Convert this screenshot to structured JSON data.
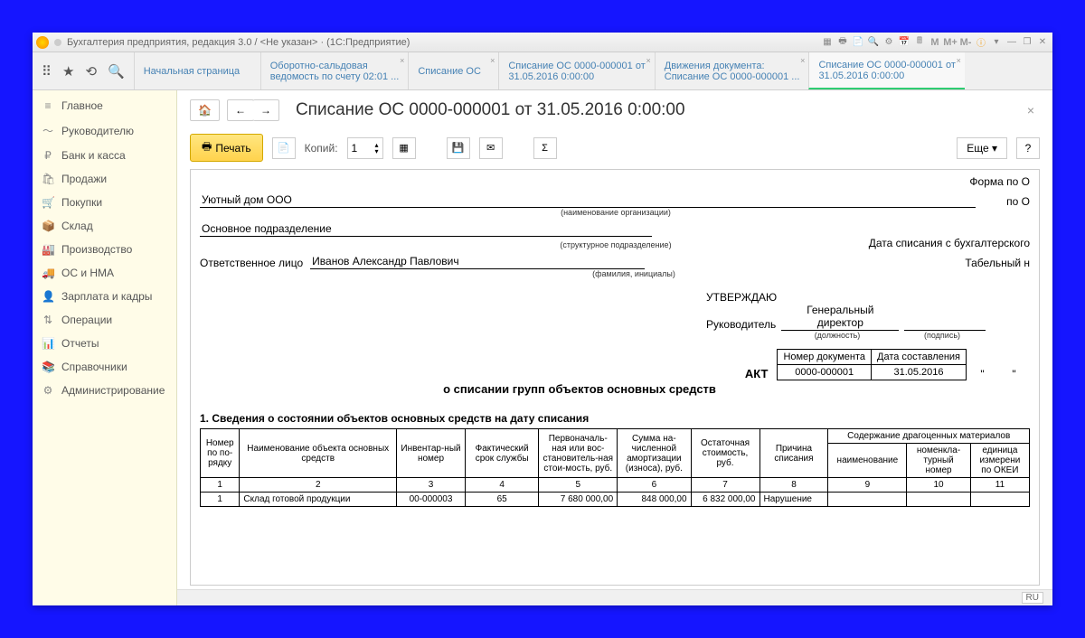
{
  "titlebar": {
    "text": "Бухгалтерия предприятия, редакция 3.0 / <Не указан> · (1С:Предприятие)"
  },
  "sysicons": {
    "m1": "M",
    "m2": "M+",
    "m3": "M-"
  },
  "tabs": [
    {
      "l1": "Начальная страница",
      "l2": ""
    },
    {
      "l1": "Оборотно-сальдовая",
      "l2": "ведомость по счету 02:01 ..."
    },
    {
      "l1": "Списание ОС",
      "l2": ""
    },
    {
      "l1": "Списание ОС 0000-000001 от",
      "l2": "31.05.2016 0:00:00"
    },
    {
      "l1": "Движения документа:",
      "l2": "Списание ОС 0000-000001 ..."
    },
    {
      "l1": "Списание ОС 0000-000001 от",
      "l2": "31.05.2016 0:00:00"
    }
  ],
  "sidebar": [
    {
      "ic": "≡",
      "t": "Главное"
    },
    {
      "ic": "〜",
      "t": "Руководителю"
    },
    {
      "ic": "₽",
      "t": "Банк и касса"
    },
    {
      "ic": "🛍",
      "t": "Продажи"
    },
    {
      "ic": "🛒",
      "t": "Покупки"
    },
    {
      "ic": "📦",
      "t": "Склад"
    },
    {
      "ic": "🏭",
      "t": "Производство"
    },
    {
      "ic": "🚚",
      "t": "ОС и НМА"
    },
    {
      "ic": "👤",
      "t": "Зарплата и кадры"
    },
    {
      "ic": "⇅",
      "t": "Операции"
    },
    {
      "ic": "📊",
      "t": "Отчеты"
    },
    {
      "ic": "📚",
      "t": "Справочники"
    },
    {
      "ic": "⚙",
      "t": "Администрирование"
    }
  ],
  "page": {
    "title": "Списание ОС 0000-000001 от 31.05.2016 0:00:00"
  },
  "toolbar": {
    "print": "Печать",
    "copies": "Копий:",
    "copiesval": "1",
    "more": "Еще",
    "help": "?"
  },
  "form": {
    "okud": "Форма по О",
    "okpo": "по О",
    "org": "Уютный дом ООО",
    "orgcap": "(наименование организации)",
    "dept": "Основное подразделение",
    "deptcap": "(структурное подразделение)",
    "datenote": "Дата списания с бухгалтерского",
    "resp": "Ответственное лицо",
    "person": "Иванов Александр Павлович",
    "personcap": "(фамилия, инициалы)",
    "tabnote": "Табельный н",
    "approve": "УТВЕРЖДАЮ",
    "rukov": "Руководитель",
    "position": "Генеральный директор",
    "poscap": "(должность)",
    "sigcap": "(подпись)",
    "docnum_h": "Номер документа",
    "docdate_h": "Дата составления",
    "docnum": "0000-000001",
    "docdate": "31.05.2016",
    "quote": "\"",
    "act": "АКТ",
    "actsub": "о списании групп объектов основных средств",
    "sec1": "1. Сведения о состоянии объектов основных средств на дату списания"
  },
  "cols": {
    "c1": "Номер по по-рядку",
    "c2": "Наименование объекта основных средств",
    "c3": "Инвентар-ный номер",
    "c4": "Фактический срок службы",
    "c5": "Первоначаль-ная или вос-становитель-ная стои-мость, руб.",
    "c6": "Сумма на-численной амортизации (износа), руб.",
    "c7": "Остаточная стоимость, руб.",
    "c8": "Причина списания",
    "c9g": "Содержание драгоценных материалов",
    "c9": "наименование",
    "c10": "номенкла-турный номер",
    "c11": "единица измерени по ОКЕИ"
  },
  "nums": {
    "n1": "1",
    "n2": "2",
    "n3": "3",
    "n4": "4",
    "n5": "5",
    "n6": "6",
    "n7": "7",
    "n8": "8",
    "n9": "9",
    "n10": "10",
    "n11": "11"
  },
  "row": {
    "r1": "1",
    "r2": "Склад готовой продукции",
    "r3": "00-000003",
    "r4": "65",
    "r5": "7 680 000,00",
    "r6": "848 000,00",
    "r7": "6 832 000,00",
    "r8": "Нарушение",
    "r9": "",
    "r10": "",
    "r11": ""
  },
  "status": {
    "lang": "RU"
  }
}
